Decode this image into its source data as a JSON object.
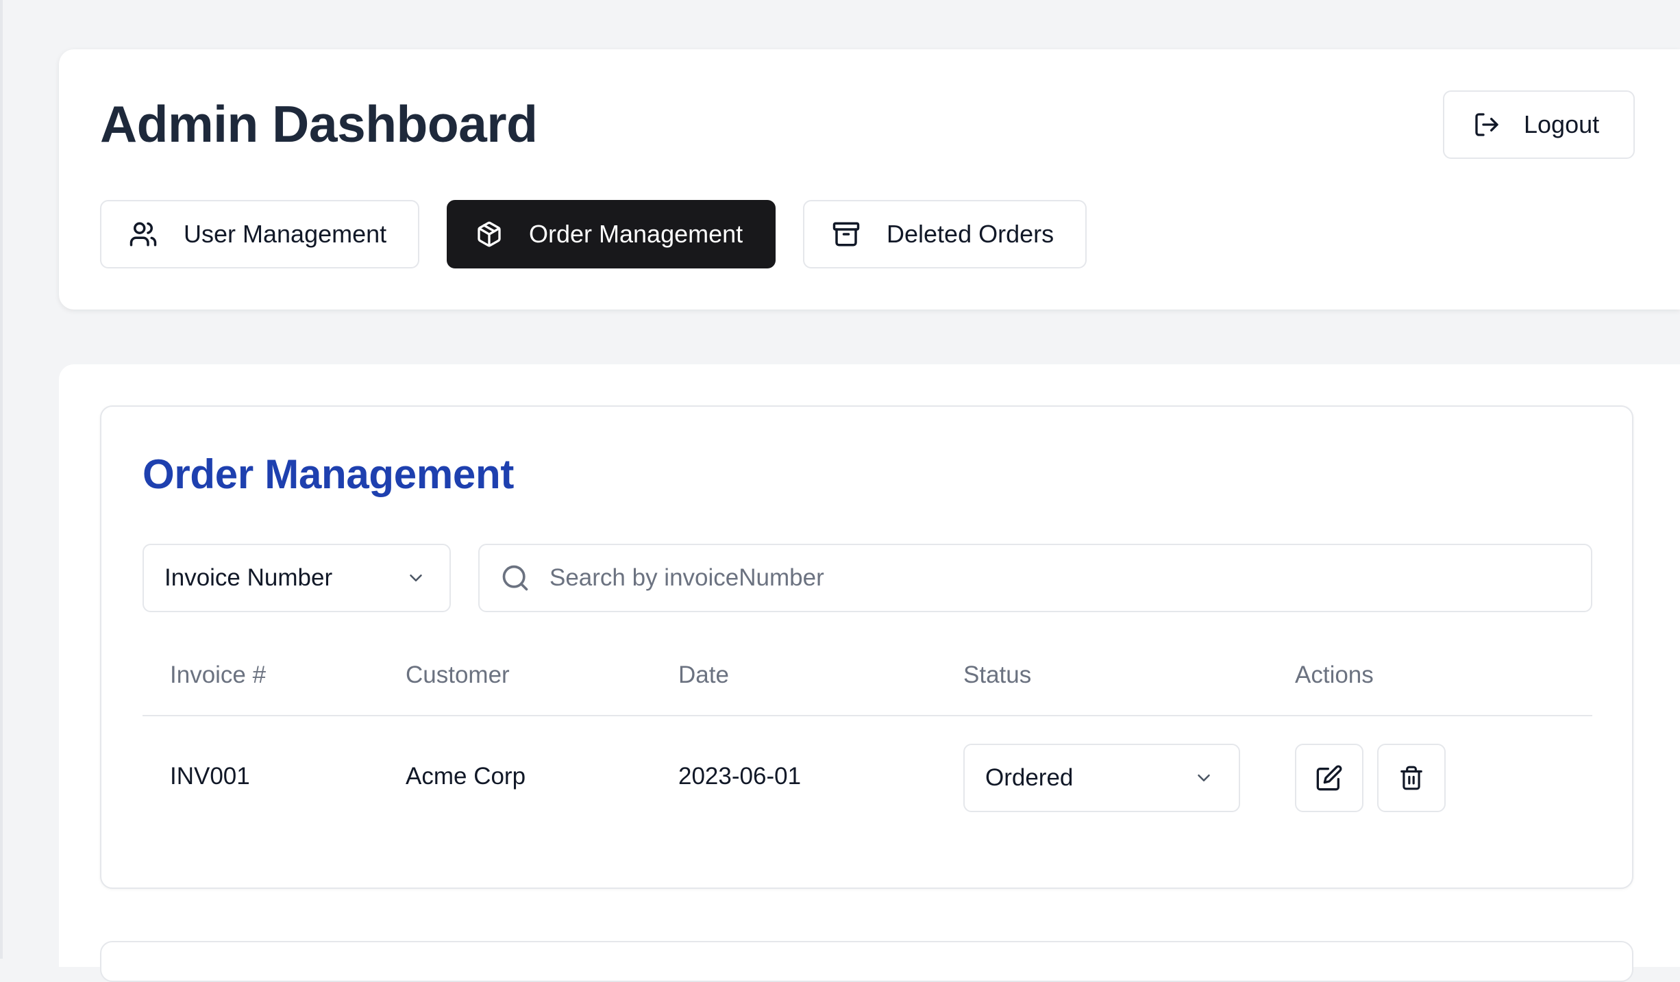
{
  "header": {
    "title": "Admin Dashboard",
    "logout_label": "Logout",
    "logout_icon": "logout-icon"
  },
  "tabs": [
    {
      "label": "User Management",
      "icon": "users-icon",
      "active": false
    },
    {
      "label": "Order Management",
      "icon": "package-icon",
      "active": true
    },
    {
      "label": "Deleted Orders",
      "icon": "archive-icon",
      "active": false
    }
  ],
  "orders": {
    "title": "Order Management",
    "filter": {
      "selected": "Invoice Number"
    },
    "search": {
      "placeholder": "Search by invoiceNumber",
      "value": ""
    },
    "columns": [
      "Invoice #",
      "Customer",
      "Date",
      "Status",
      "Actions"
    ],
    "rows": [
      {
        "invoice": "INV001",
        "customer": "Acme Corp",
        "date": "2023-06-01",
        "status": "Ordered"
      }
    ]
  },
  "colors": {
    "accent_title": "#1e40af",
    "active_tab_bg": "#18181b",
    "page_bg": "#f3f4f6"
  }
}
